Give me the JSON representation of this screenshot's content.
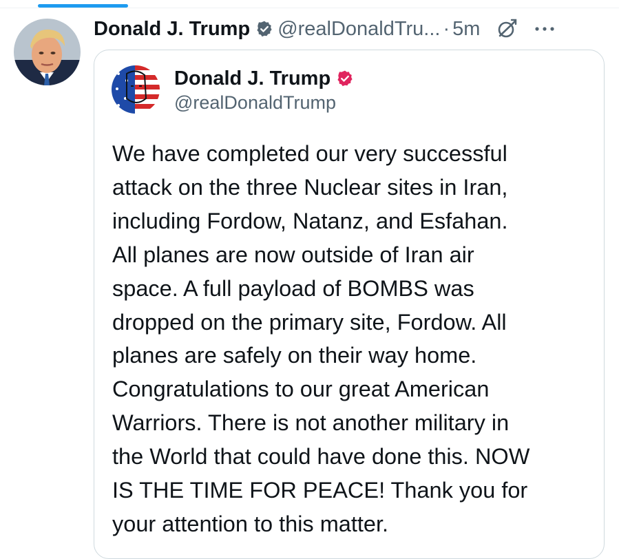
{
  "post": {
    "author_name": "Donald J. Trump",
    "author_handle": "@realDonaldTru...",
    "separator": "·",
    "time": "5m",
    "verified_color": "#536471",
    "icons": [
      "verified-badge-icon",
      "grok-icon",
      "more-icon"
    ]
  },
  "quote": {
    "author_name": "Donald J. Trump",
    "author_handle": "@realDonaldTrump",
    "badge_color": "#e0245e",
    "body_lines": [
      "We have completed our very successful",
      "attack on the three Nuclear sites in Iran,",
      "including Fordow, Natanz, and Esfahan.",
      "All planes are now outside of Iran air",
      "space. A full payload of BOMBS was",
      "dropped on the primary site, Fordow. All",
      "planes are safely on their way home.",
      "Congratulations to our great American",
      "Warriors. There is not another military in",
      "the World that could have done this. NOW",
      "IS THE TIME FOR PEACE! Thank you for",
      "your attention to this matter."
    ]
  },
  "colors": {
    "accent": "#1d9bf0",
    "text": "#0f1419",
    "secondary": "#536471",
    "border": "#cfd9de"
  }
}
